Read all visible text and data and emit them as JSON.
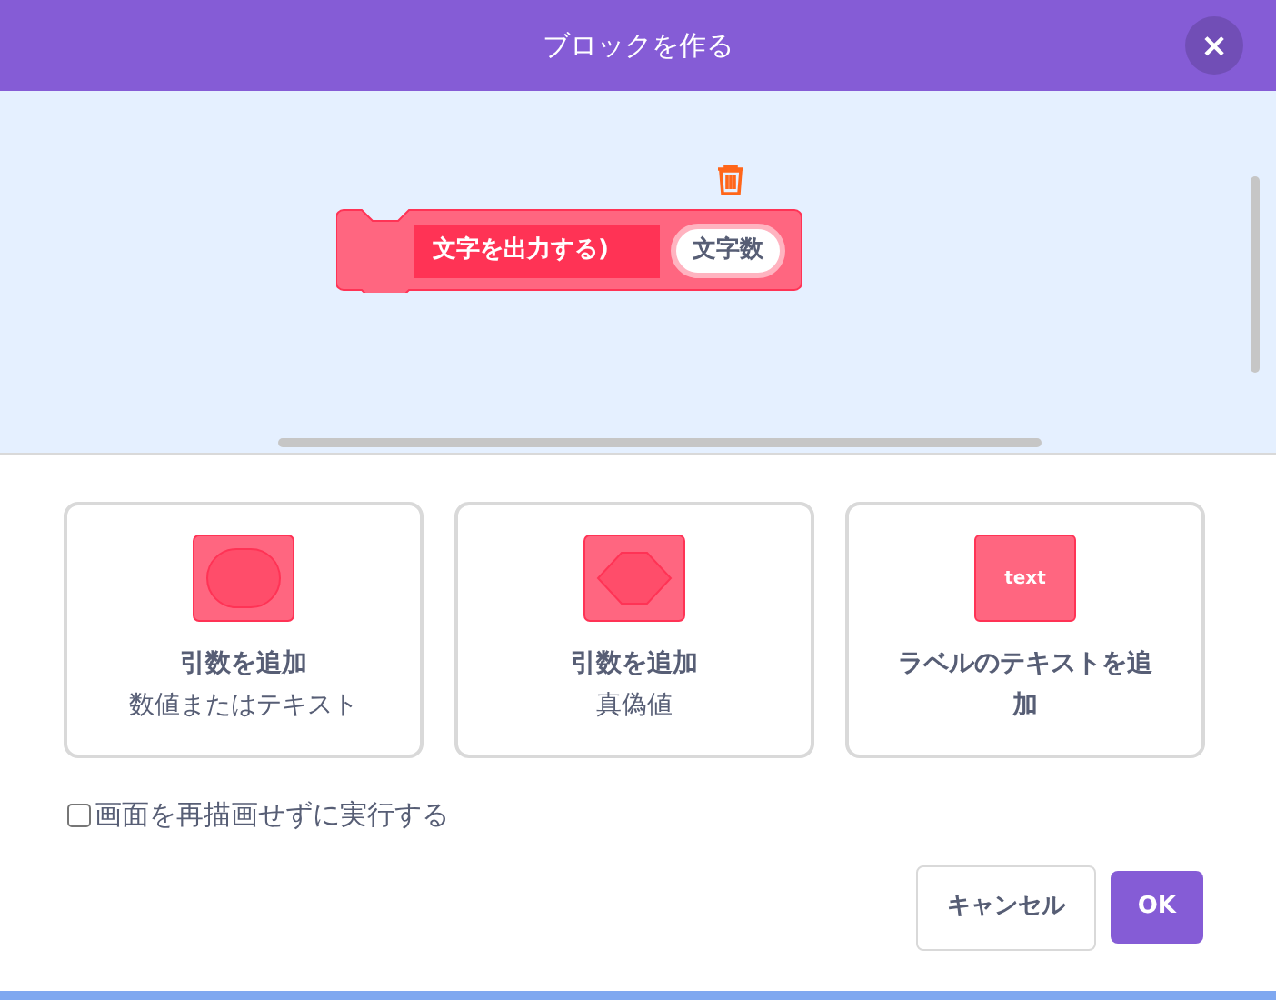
{
  "dialog": {
    "title": "ブロックを作る",
    "close": "×"
  },
  "block": {
    "label": "文字を出力する)",
    "argument": "文字数"
  },
  "options": [
    {
      "kind": "oval",
      "title": "引数を追加",
      "subtitle": "数値またはテキスト"
    },
    {
      "kind": "diamond",
      "title": "引数を追加",
      "subtitle": "真偽値"
    },
    {
      "kind": "label",
      "icon_text": "text",
      "title": "ラベルのテキストを追加"
    }
  ],
  "checkbox": {
    "label": "画面を再描画せずに実行する",
    "checked": false
  },
  "buttons": [
    {
      "kind": "secondary",
      "label": "キャンセル"
    },
    {
      "kind": "primary",
      "label": "OK"
    }
  ]
}
